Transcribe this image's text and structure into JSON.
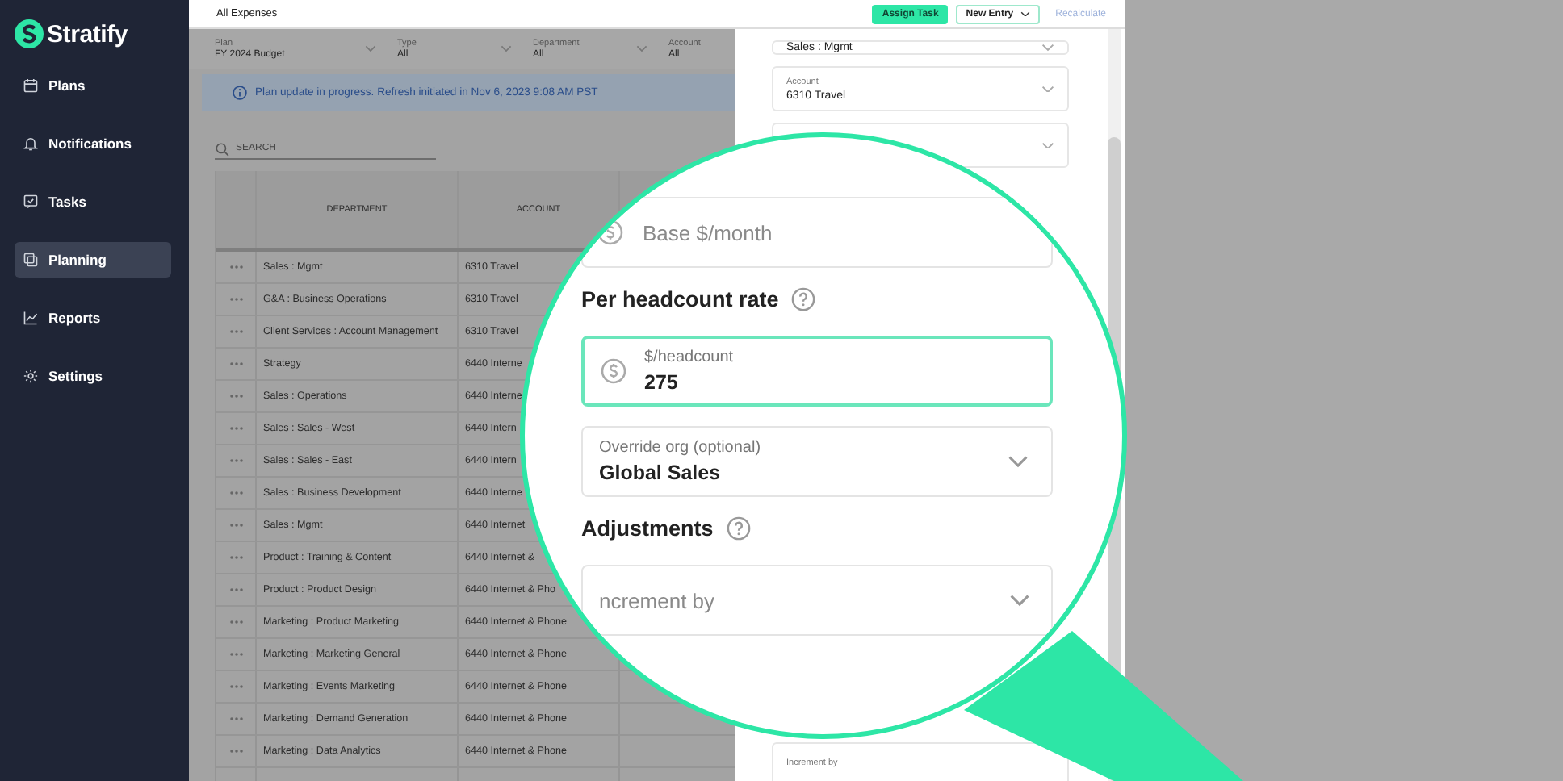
{
  "sidebar": {
    "brand": "Stratify",
    "items": [
      {
        "label": "Plans",
        "selected": false
      },
      {
        "label": "Notifications",
        "selected": false
      },
      {
        "label": "Tasks",
        "selected": false
      },
      {
        "label": "Planning",
        "selected": true
      },
      {
        "label": "Reports",
        "selected": false
      },
      {
        "label": "Settings",
        "selected": false
      }
    ]
  },
  "top_bar": {
    "title": "All Expenses",
    "buttons": [
      {
        "label": "Assign Task",
        "kind": "primary",
        "disabled": false
      },
      {
        "label": "New Entry",
        "kind": "dropdown",
        "disabled": false
      },
      {
        "label": "Recalculate",
        "kind": "link",
        "disabled": true
      }
    ]
  },
  "filters": [
    {
      "label": "Plan",
      "value": "FY 2024 Budget"
    },
    {
      "label": "Type",
      "value": "All"
    },
    {
      "label": "Department",
      "value": "All"
    },
    {
      "label": "Account",
      "value": "All"
    }
  ],
  "banner": {
    "message": "Plan update in progress. Refresh initiated in Nov 6, 2023 9:08 AM PST"
  },
  "search": {
    "placeholder": "SEARCH"
  },
  "table": {
    "columns": [
      "DEPARTMENT",
      "ACCOUNT"
    ],
    "rows": [
      {
        "department": "Sales : Mgmt",
        "account": "6310 Travel"
      },
      {
        "department": "G&A : Business Operations",
        "account": "6310 Travel"
      },
      {
        "department": "Client Services : Account Management",
        "account": "6310 Travel"
      },
      {
        "department": "Strategy",
        "account": "6440 Interne"
      },
      {
        "department": "Sales : Operations",
        "account": "6440 Interne"
      },
      {
        "department": "Sales : Sales - West",
        "account": "6440 Intern"
      },
      {
        "department": "Sales : Sales - East",
        "account": "6440 Intern"
      },
      {
        "department": "Sales : Business Development",
        "account": "6440 Interne"
      },
      {
        "department": "Sales : Mgmt",
        "account": "6440 Internet"
      },
      {
        "department": "Product : Training & Content",
        "account": "6440 Internet &"
      },
      {
        "department": "Product : Product Design",
        "account": "6440 Internet & Pho"
      },
      {
        "department": "Marketing : Product Marketing",
        "account": "6440 Internet & Phone"
      },
      {
        "department": "Marketing : Marketing General",
        "account": "6440 Internet & Phone"
      },
      {
        "department": "Marketing : Events Marketing",
        "account": "6440 Internet & Phone"
      },
      {
        "department": "Marketing : Demand Generation",
        "account": "6440 Internet & Phone"
      },
      {
        "department": "Marketing : Data Analytics",
        "account": "6440 Internet & Phone"
      }
    ]
  },
  "side_panel": {
    "fields": [
      {
        "kind": "select",
        "value": "Sales : Mgmt"
      },
      {
        "kind": "select",
        "label": "Account",
        "value": "6310 Travel"
      },
      {
        "kind": "select"
      },
      {
        "kind": "select",
        "label": "Increment by"
      }
    ]
  },
  "magnifier": {
    "items": [
      {
        "kind": "currency",
        "placeholder": "Base $/month",
        "focused": false
      },
      {
        "kind": "heading",
        "text": "Per headcount rate"
      },
      {
        "kind": "currency",
        "label": "$/headcount",
        "value": "275",
        "focused": true
      },
      {
        "kind": "select",
        "label": "Override org (optional)",
        "value": "Global Sales",
        "focused": false
      },
      {
        "kind": "heading",
        "text": "Adjustments"
      },
      {
        "kind": "select",
        "placeholder": "ncrement by",
        "focused": false
      }
    ]
  }
}
